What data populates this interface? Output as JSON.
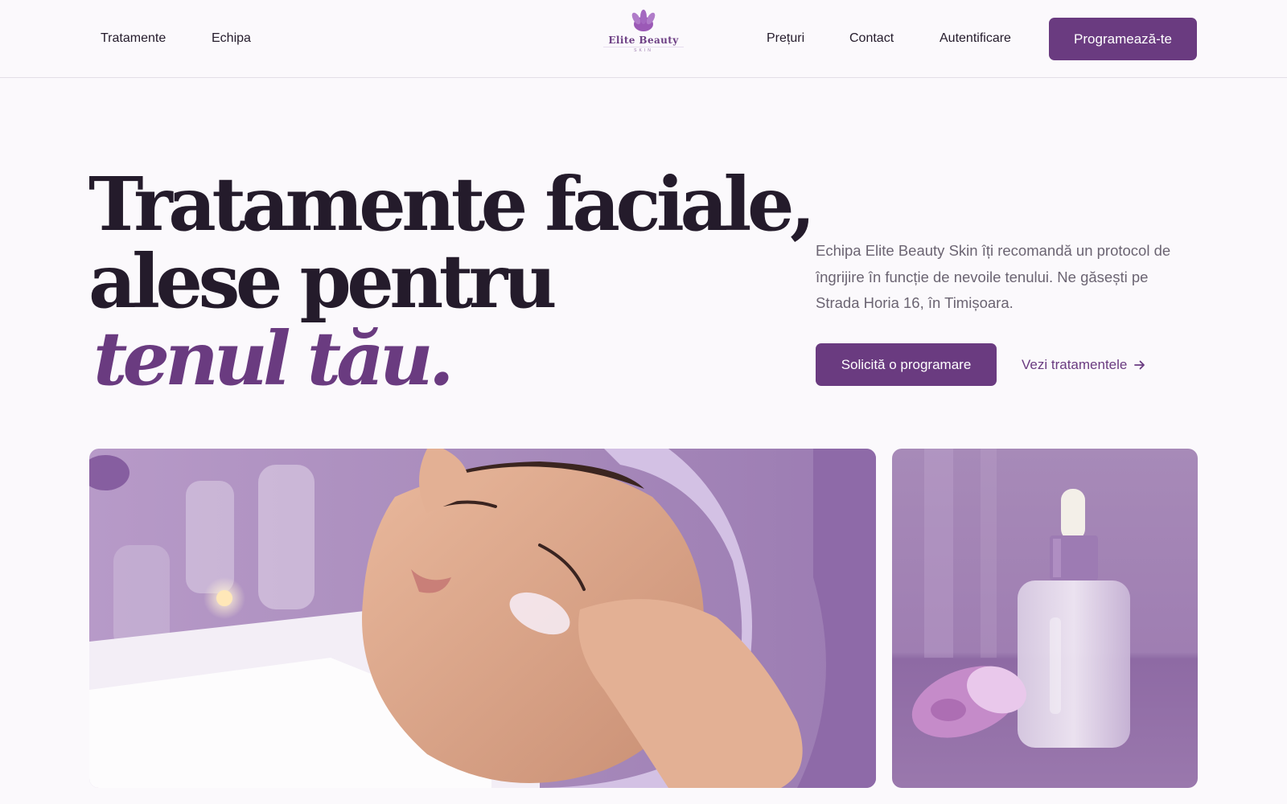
{
  "nav": {
    "left_items": [
      "Tratamente",
      "Echipa"
    ],
    "right_items": [
      "Prețuri",
      "Contact",
      "Autentificare"
    ],
    "cta": "Programează-te"
  },
  "logo": {
    "name": "Elite Beauty",
    "subtitle": "SKIN",
    "icon": "lotus-icon",
    "color": "#9b59b6"
  },
  "hero": {
    "title_line1": "Tratamente faciale,",
    "title_line2": "alese pentru",
    "title_accent": "tenul tău.",
    "description": "Echipa Elite Beauty Skin îți recomandă un protocol de îngrijire în funcție de nevoile tenului. Ne găsești pe Strada Horia 16, în Timișoara.",
    "primary_button": "Solicită o programare",
    "secondary_link": "Vezi tratamentele",
    "secondary_icon": "arrow-right-icon"
  },
  "images": {
    "main": "facial-treatment-photo",
    "side": "serum-bottle-orchid-photo"
  },
  "colors": {
    "accent": "#6a3b80",
    "text": "#241b2b",
    "muted": "#6b6472",
    "background": "#fbf9fc"
  }
}
